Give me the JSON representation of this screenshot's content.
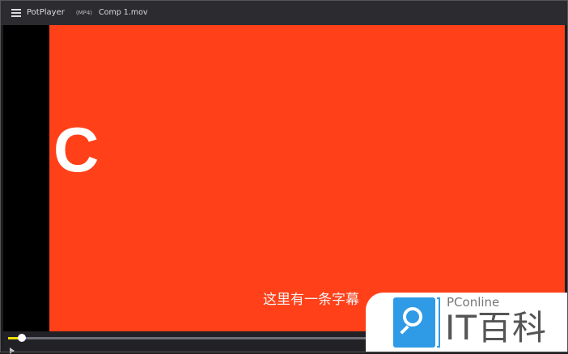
{
  "titlebar": {
    "app_name": "PotPlayer",
    "format": "(MP4)",
    "file_name": "Comp 1.mov"
  },
  "video": {
    "letter": "C",
    "subtitle": "这里有一条字幕"
  },
  "playback": {
    "progress_percent": 2.5
  },
  "watermark": {
    "brand": "PConline",
    "title": "IT百科"
  },
  "colors": {
    "video_bg": "#ff4019",
    "progress": "#f0e000",
    "watermark_blue": "#2f9be6"
  }
}
